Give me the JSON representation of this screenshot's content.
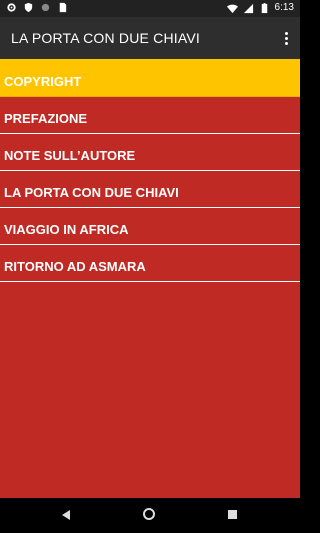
{
  "status_bar": {
    "time": "6:13",
    "left_icons": [
      "gear-icon",
      "shield-icon",
      "circle-icon",
      "sd-card-icon"
    ],
    "right_icons": [
      "wifi-icon",
      "signal-icon",
      "battery-icon"
    ]
  },
  "appbar": {
    "title": "LA PORTA CON DUE CHIAVI",
    "menu_icon": "overflow-menu-icon"
  },
  "menu": {
    "items": [
      {
        "label": "COPYRIGHT",
        "highlighted": true
      },
      {
        "label": "PREFAZIONE",
        "highlighted": false
      },
      {
        "label": "NOTE SULL’AUTORE",
        "highlighted": false
      },
      {
        "label": "LA PORTA CON DUE CHIAVI",
        "highlighted": false
      },
      {
        "label": "VIAGGIO IN AFRICA",
        "highlighted": false
      },
      {
        "label": "RITORNO AD ASMARA",
        "highlighted": false
      }
    ]
  },
  "colors": {
    "background": "#bf2b24",
    "highlight": "#fec400",
    "appbar": "#2e2e2e"
  },
  "navbar": {
    "icons": [
      "back-icon",
      "home-icon",
      "recent-apps-icon"
    ]
  }
}
